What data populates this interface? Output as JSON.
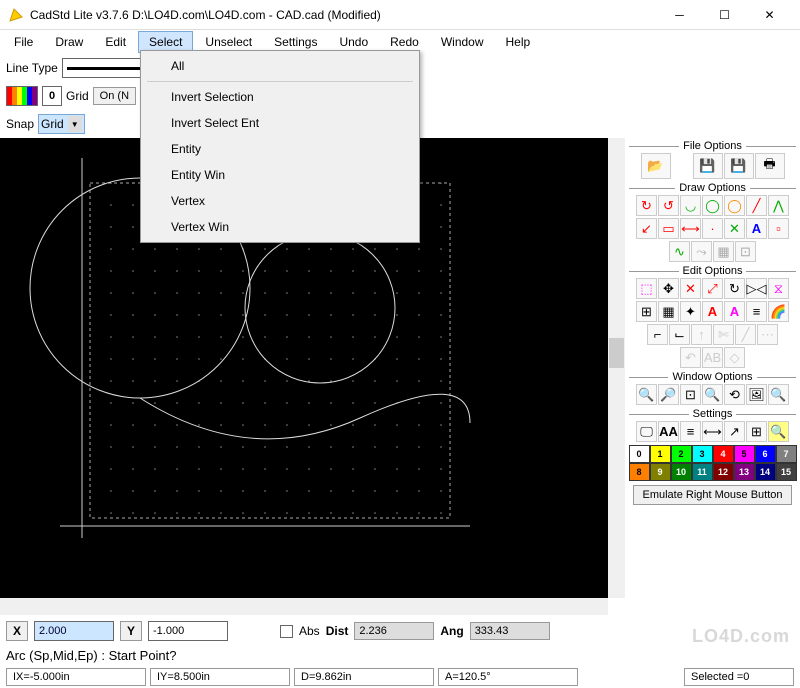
{
  "title": "CadStd Lite v3.7.6   D:\\LO4D.com\\LO4D.com - CAD.cad  (Modified)",
  "menus": [
    "File",
    "Draw",
    "Edit",
    "Select",
    "Unselect",
    "Settings",
    "Undo",
    "Redo",
    "Window",
    "Help"
  ],
  "activeMenu": 3,
  "dropdownItems": [
    "All",
    "Invert Selection",
    "Invert Select Ent",
    "Entity",
    "Entity Win",
    "Vertex",
    "Vertex Win"
  ],
  "toolbar": {
    "lineTypeLabel": "Line Type",
    "gridLabel": "Grid",
    "gridButton": "On (N",
    "snapLabel": "Snap",
    "snapValue": "Grid",
    "colorNum": "0"
  },
  "sidePanel": {
    "fileHeader": "File Options",
    "drawHeader": "Draw Options",
    "editHeader": "Edit Options",
    "windowHeader": "Window Options",
    "settingsHeader": "Settings",
    "emulateButton": "Emulate Right Mouse Button"
  },
  "colorPalette": [
    {
      "n": "0",
      "bg": "#fff",
      "fg": "#000"
    },
    {
      "n": "1",
      "bg": "#ff0",
      "fg": "#000"
    },
    {
      "n": "2",
      "bg": "#0f0",
      "fg": "#000"
    },
    {
      "n": "3",
      "bg": "#0ff",
      "fg": "#000"
    },
    {
      "n": "4",
      "bg": "#f00",
      "fg": "#fff"
    },
    {
      "n": "5",
      "bg": "#f0f",
      "fg": "#000"
    },
    {
      "n": "6",
      "bg": "#00f",
      "fg": "#fff"
    },
    {
      "n": "7",
      "bg": "#808080",
      "fg": "#fff"
    },
    {
      "n": "8",
      "bg": "#ff8000",
      "fg": "#000"
    },
    {
      "n": "9",
      "bg": "#808000",
      "fg": "#fff"
    },
    {
      "n": "10",
      "bg": "#008000",
      "fg": "#fff"
    },
    {
      "n": "11",
      "bg": "#008080",
      "fg": "#fff"
    },
    {
      "n": "12",
      "bg": "#800000",
      "fg": "#fff"
    },
    {
      "n": "13",
      "bg": "#800080",
      "fg": "#fff"
    },
    {
      "n": "14",
      "bg": "#000080",
      "fg": "#fff"
    },
    {
      "n": "15",
      "bg": "#404040",
      "fg": "#fff"
    }
  ],
  "bottomBar": {
    "xLabel": "X",
    "xValue": "2.000",
    "yLabel": "Y",
    "yValue": "-1.000",
    "absLabel": "Abs",
    "distLabel": "Dist",
    "distValue": "2.236",
    "angLabel": "Ang",
    "angValue": "333.43",
    "prompt": "Arc (Sp,Mid,Ep) : Start Point?",
    "ix": "IX=-5.000in",
    "iy": "IY=8.500in",
    "d": "D=9.862in",
    "a": "A=120.5°",
    "selected": "Selected =0"
  },
  "watermark": "LO4D.com"
}
